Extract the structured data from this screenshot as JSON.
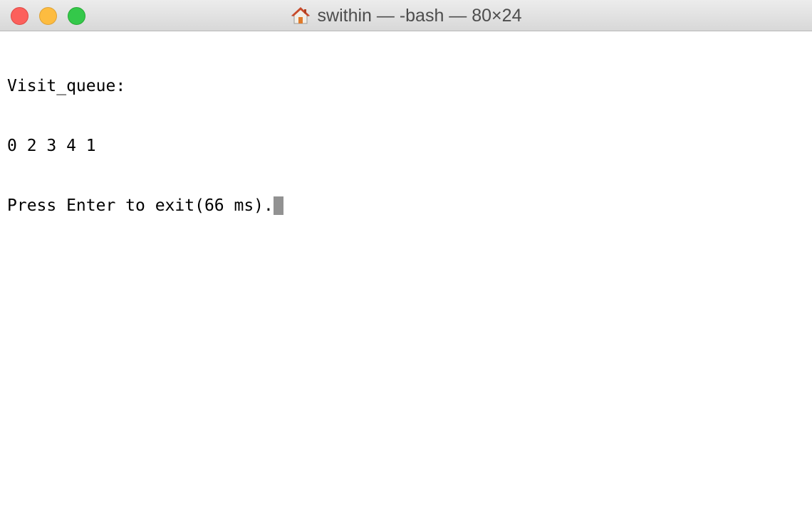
{
  "window": {
    "title": "swithin — -bash — 80×24",
    "title_icon": "home-icon"
  },
  "terminal": {
    "lines": [
      "Visit_queue:",
      "0 2 3 4 1",
      "Press Enter to exit(66 ms)."
    ],
    "cursor_color": "#929292"
  },
  "colors": {
    "close": "#fc605c",
    "minimize": "#fdbc40",
    "zoom": "#34c84a"
  }
}
